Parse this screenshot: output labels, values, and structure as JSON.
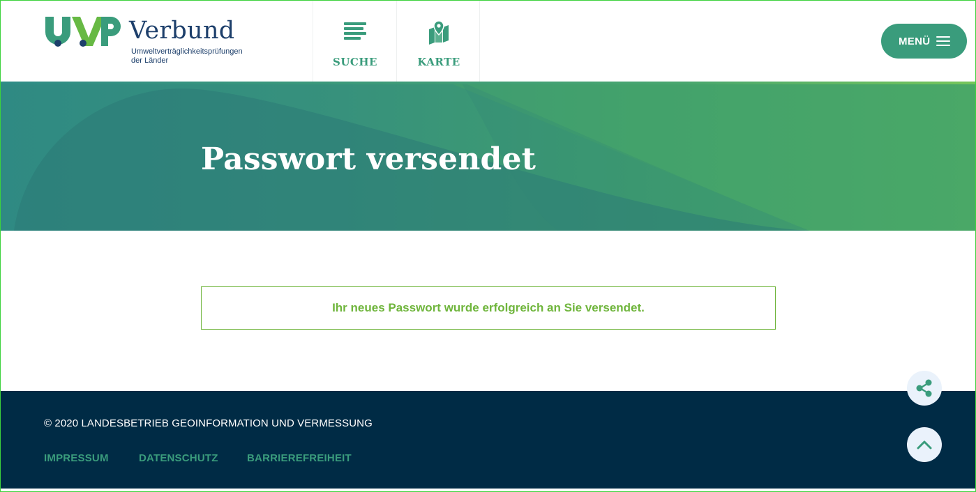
{
  "header": {
    "logo": {
      "mark": "UVP",
      "word": "Verbund",
      "subtitle_line1": "Umweltverträglichkeitsprüfungen",
      "subtitle_line2": "der Länder"
    },
    "nav": [
      {
        "label": "SUCHE",
        "icon": "search-list-icon"
      },
      {
        "label": "KARTE",
        "icon": "map-pin-icon"
      }
    ],
    "menu_label": "MENÜ",
    "menu_icon": "hamburger-icon"
  },
  "hero": {
    "title": "Passwort versendet"
  },
  "message": {
    "text": "Ihr neues Passwort wurde erfolgreich an Sie versendet."
  },
  "floating": {
    "share_icon": "share-icon",
    "top_icon": "chevron-up-icon"
  },
  "footer": {
    "copyright": "© 2020 LANDESBETRIEB GEOINFORMATION UND VERMESSUNG",
    "links": [
      "IMPRESSUM",
      "DATENSCHUTZ",
      "BARRIEREFREIHEIT"
    ]
  },
  "colors": {
    "brand_green": "#3a9c7c",
    "message_green": "#6fb53c",
    "navy": "#002b45",
    "logo_blue": "#1d3f6b"
  }
}
